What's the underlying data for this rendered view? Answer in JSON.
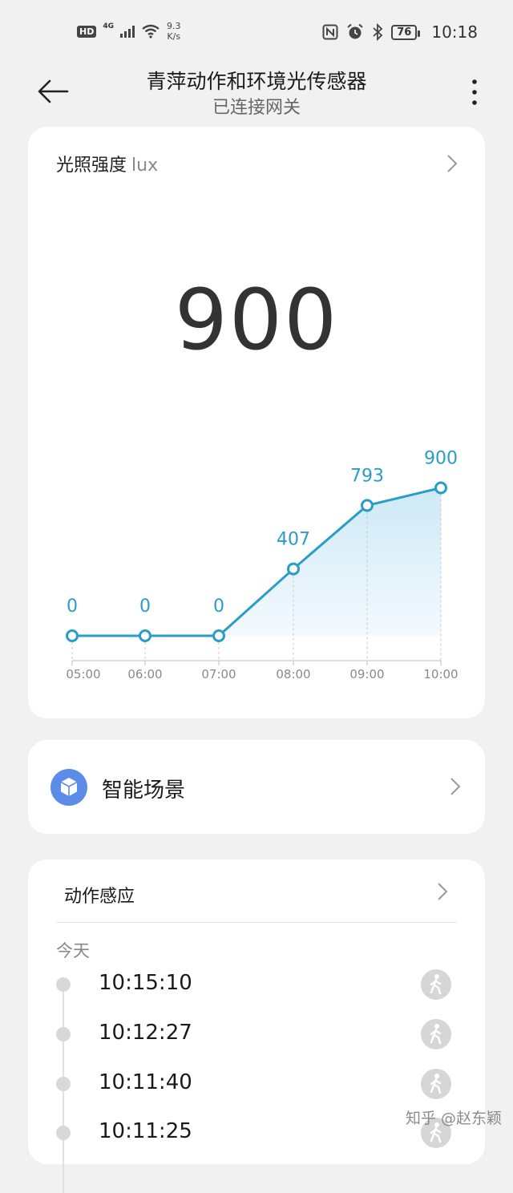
{
  "status_bar": {
    "hd": "HD",
    "network": "4G",
    "speed_value": "9.3",
    "speed_unit": "K/s",
    "battery": "76",
    "time": "10:18",
    "icons": [
      "nfc-icon",
      "alarm-icon",
      "bluetooth-icon",
      "battery-icon",
      "wifi-icon",
      "signal-icon"
    ]
  },
  "header": {
    "title": "青萍动作和环境光传感器",
    "subtitle": "已连接网关"
  },
  "light": {
    "label": "光照强度",
    "unit": "lux",
    "current_value": "900"
  },
  "chart_data": {
    "type": "line",
    "categories": [
      "05:00",
      "06:00",
      "07:00",
      "08:00",
      "09:00",
      "10:00"
    ],
    "values": [
      0,
      0,
      0,
      407,
      793,
      900
    ],
    "ylim": [
      0,
      1000
    ],
    "grid": false,
    "area_fill": true,
    "colors": {
      "line": "#2a9dc7",
      "fill_top": "#cde9f6",
      "fill_bottom": "#f4fafd",
      "labels": "#2a9dc7"
    }
  },
  "scene": {
    "label": "智能场景",
    "icon": "cube-icon",
    "icon_color": "#5b8de8"
  },
  "motion": {
    "title": "动作感应",
    "day_label": "今天",
    "events": [
      {
        "time": "10:15:10",
        "icon": "walking-person-icon"
      },
      {
        "time": "10:12:27",
        "icon": "walking-person-icon"
      },
      {
        "time": "10:11:40",
        "icon": "walking-person-icon"
      },
      {
        "time": "10:11:25",
        "icon": "walking-person-icon"
      }
    ]
  },
  "watermark": "知乎 @赵东颖"
}
